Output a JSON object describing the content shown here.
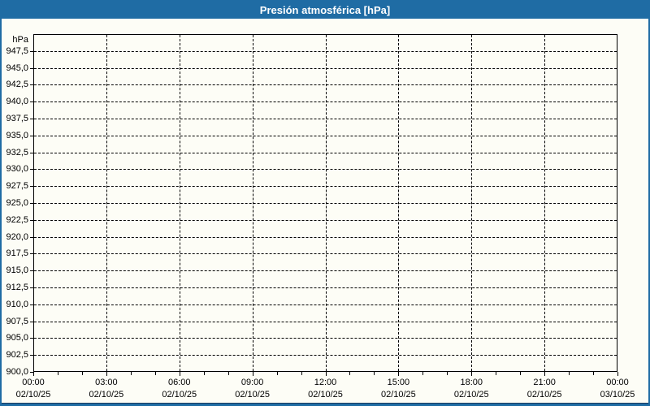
{
  "window": {
    "title": "Presión atmosférica [hPa]"
  },
  "colors": {
    "titlebar": "#1F6CA4",
    "frame": "#1F6CA4",
    "background": "#FDFDF6",
    "grid": "#000000",
    "text": "#000000",
    "title_text": "#FFFFFF",
    "bottom_edge": "#1B3A5E"
  },
  "chart_data": {
    "type": "line",
    "title": "Presión atmosférica [hPa]",
    "ylabel": "hPa",
    "ylim": [
      900,
      950
    ],
    "ytick_step": 2.5,
    "ytick_labels": [
      "947,5",
      "945,0",
      "942,5",
      "940,0",
      "937,5",
      "935,0",
      "932,5",
      "930,0",
      "927,5",
      "925,0",
      "922,5",
      "920,0",
      "917,5",
      "915,0",
      "912,5",
      "910,0",
      "907,5",
      "905,0",
      "902,5",
      "900,0"
    ],
    "xtick_labels": [
      {
        "time": "00:00",
        "date": "02/10/25"
      },
      {
        "time": "03:00",
        "date": "02/10/25"
      },
      {
        "time": "06:00",
        "date": "02/10/25"
      },
      {
        "time": "09:00",
        "date": "02/10/25"
      },
      {
        "time": "12:00",
        "date": "02/10/25"
      },
      {
        "time": "15:00",
        "date": "02/10/25"
      },
      {
        "time": "18:00",
        "date": "02/10/25"
      },
      {
        "time": "21:00",
        "date": "02/10/25"
      },
      {
        "time": "00:00",
        "date": "03/10/25"
      }
    ],
    "x_minor_ticks_per_hour": 1,
    "grid": true,
    "legend": false,
    "series": []
  }
}
